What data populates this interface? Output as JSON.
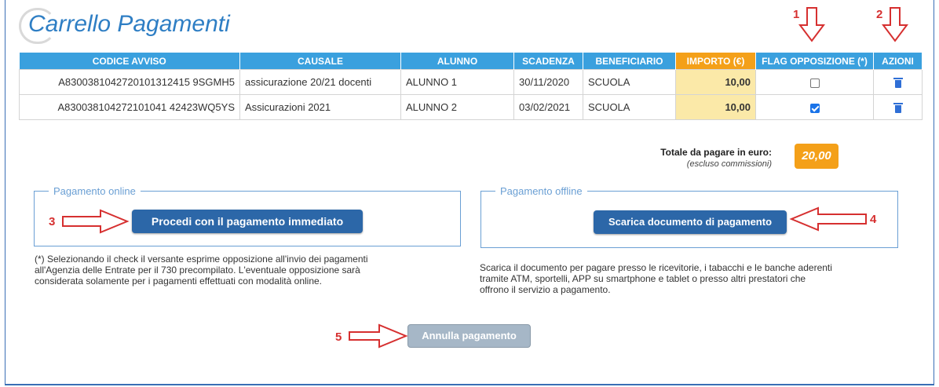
{
  "page": {
    "title": "Carrello Pagamenti"
  },
  "table": {
    "headers": [
      "CODICE AVVISO",
      "CAUSALE",
      "ALUNNO",
      "SCADENZA",
      "BENEFICIARIO",
      "IMPORTO (€)",
      "FLAG OPPOSIZIONE (*)",
      "AZIONI"
    ],
    "rows": [
      {
        "codice": "A8300381042720101312415 9SGMH5",
        "causale": "assicurazione 20/21 docenti",
        "alunno": "ALUNNO 1",
        "scadenza": "30/11/2020",
        "beneficiario": "SCUOLA",
        "importo": "10,00",
        "flag": false
      },
      {
        "codice": "A830038104272101041 42423WQ5YS",
        "causale": "Assicurazioni 2021",
        "alunno": "ALUNNO 2",
        "scadenza": "03/02/2021",
        "beneficiario": "SCUOLA",
        "importo": "10,00",
        "flag": true
      }
    ]
  },
  "totale": {
    "label": "Totale da pagare in euro:",
    "sub": "(escluso commissioni)",
    "value": "20,00"
  },
  "online": {
    "legend": "Pagamento online",
    "button": "Procedi con il pagamento immediato",
    "note_lines": [
      "(*) Selezionando il check il versante esprime opposizione all'invio dei pagamenti",
      "all'Agenzia delle Entrate per il 730 precompilato. L'eventuale opposizione sarà",
      "considerata solamente per i pagamenti effettuati con modalità online."
    ]
  },
  "offline": {
    "legend": "Pagamento offline",
    "button": "Scarica documento di pagamento",
    "note_lines": [
      "Scarica il documento per pagare presso le ricevitorie, i tabacchi e le banche aderenti",
      "tramite ATM, sportelli, APP su smartphone e tablet o presso altri prestatori che",
      "offrono il servizio a pagamento."
    ]
  },
  "annulla": {
    "button": "Annulla pagamento"
  },
  "annotations": [
    "1",
    "2",
    "3",
    "4",
    "5"
  ],
  "colors": {
    "header": "#3aa0de",
    "importo_header": "#f4a019",
    "importo_cell": "#fbe9a8",
    "primary_button": "#2c67a8",
    "annotation": "#d63030"
  }
}
